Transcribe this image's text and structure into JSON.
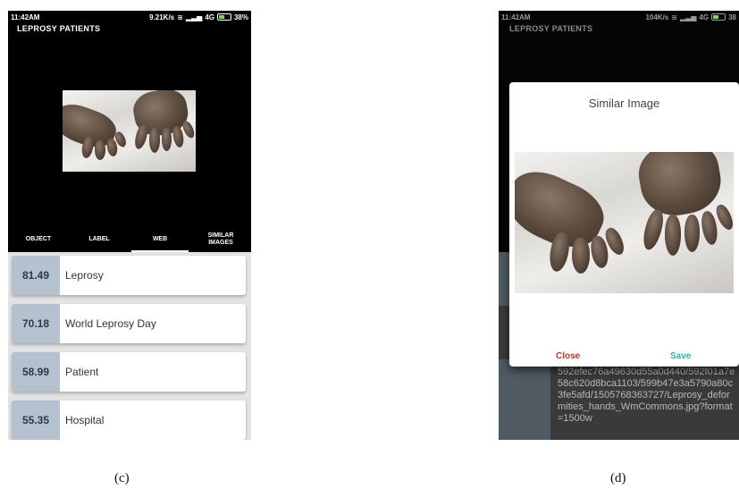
{
  "panel_c": {
    "status": {
      "time": "11:42AM",
      "speed": "9.21K/s",
      "network": "4G",
      "battery": "38%"
    },
    "app_title": "LEPROSY PATIENTS",
    "tabs": [
      {
        "label": "OBJECT"
      },
      {
        "label": "LABEL"
      },
      {
        "label": "WEB"
      },
      {
        "label": "SIMILAR IMAGES"
      }
    ],
    "active_tab": "WEB",
    "results": [
      {
        "score": "81.49",
        "label": "Leprosy"
      },
      {
        "score": "70.18",
        "label": "World Leprosy Day"
      },
      {
        "score": "58.99",
        "label": "Patient"
      },
      {
        "score": "55.35",
        "label": "Hospital"
      }
    ]
  },
  "panel_d": {
    "status": {
      "time": "11:42AM",
      "speed": "104K/s",
      "network": "4G",
      "battery": "38"
    },
    "app_title": "LEPROSY PATIENTS",
    "dialog": {
      "title": "Similar Image",
      "close_label": "Close",
      "save_label": "Save"
    },
    "url_text": "592efec76a49630d55a0d440/592f01a7e58c620d8bca1103/599b47e3a5790a80c3fe5afd/1505768363727/Leprosy_deformities_hands_WmCommons.jpg?format=1500w"
  },
  "captions": {
    "c": "(c)",
    "d": "(d)"
  },
  "colors": {
    "score_bg": "#b3c2ce",
    "close": "#c0392b",
    "save": "#2fb3b0",
    "battery": "#7ed957"
  }
}
